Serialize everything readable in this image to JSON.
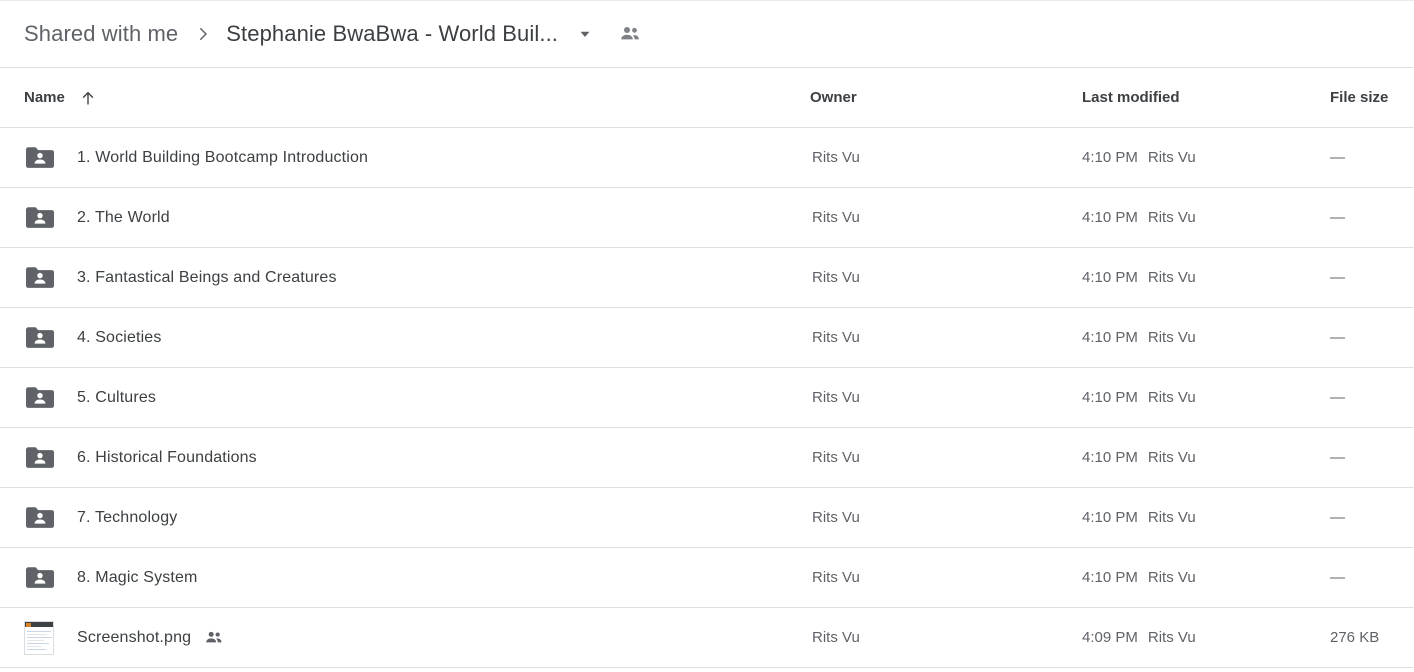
{
  "breadcrumb": {
    "root_label": "Shared with me",
    "separator": "chevron-right-icon",
    "current_label": "Stephanie BwaBwa - World Buil...",
    "caret_icon": "chevron-down-icon",
    "people_icon": "people-shared-icon"
  },
  "columns": {
    "name": "Name",
    "sort_icon": "arrow-up-icon",
    "owner": "Owner",
    "last_modified": "Last modified",
    "file_size": "File size"
  },
  "colors": {
    "text_primary": "#3c4043",
    "text_secondary": "#5f6368",
    "folder_icon": "#5f6368",
    "divider": "#e0e0e0"
  },
  "rows": [
    {
      "icon": "shared-folder-icon",
      "name": "1. World Building Bootcamp Introduction",
      "shared": false,
      "owner": "Rits Vu",
      "modified_time": "4:10 PM",
      "modified_by": "Rits Vu",
      "size": "—"
    },
    {
      "icon": "shared-folder-icon",
      "name": "2. The World",
      "shared": false,
      "owner": "Rits Vu",
      "modified_time": "4:10 PM",
      "modified_by": "Rits Vu",
      "size": "—"
    },
    {
      "icon": "shared-folder-icon",
      "name": "3. Fantastical Beings and Creatures",
      "shared": false,
      "owner": "Rits Vu",
      "modified_time": "4:10 PM",
      "modified_by": "Rits Vu",
      "size": "—"
    },
    {
      "icon": "shared-folder-icon",
      "name": "4. Societies",
      "shared": false,
      "owner": "Rits Vu",
      "modified_time": "4:10 PM",
      "modified_by": "Rits Vu",
      "size": "—"
    },
    {
      "icon": "shared-folder-icon",
      "name": "5. Cultures",
      "shared": false,
      "owner": "Rits Vu",
      "modified_time": "4:10 PM",
      "modified_by": "Rits Vu",
      "size": "—"
    },
    {
      "icon": "shared-folder-icon",
      "name": "6. Historical Foundations",
      "shared": false,
      "owner": "Rits Vu",
      "modified_time": "4:10 PM",
      "modified_by": "Rits Vu",
      "size": "—"
    },
    {
      "icon": "shared-folder-icon",
      "name": "7. Technology",
      "shared": false,
      "owner": "Rits Vu",
      "modified_time": "4:10 PM",
      "modified_by": "Rits Vu",
      "size": "—"
    },
    {
      "icon": "shared-folder-icon",
      "name": "8. Magic System",
      "shared": false,
      "owner": "Rits Vu",
      "modified_time": "4:10 PM",
      "modified_by": "Rits Vu",
      "size": "—"
    },
    {
      "icon": "image-thumbnail-icon",
      "name": "Screenshot.png",
      "shared": true,
      "owner": "Rits Vu",
      "modified_time": "4:09 PM",
      "modified_by": "Rits Vu",
      "size": "276 KB"
    }
  ]
}
